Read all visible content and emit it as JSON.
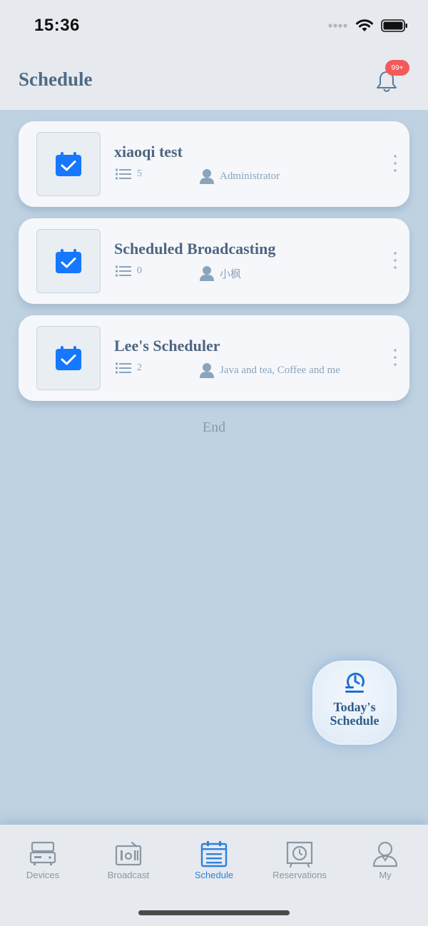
{
  "status_bar": {
    "time": "15:36"
  },
  "header": {
    "title": "Schedule",
    "notification_badge": "99+"
  },
  "schedules": [
    {
      "title": "xiaoqi test",
      "count": "5",
      "owner": "Administrator"
    },
    {
      "title": "Scheduled Broadcasting",
      "count": "0",
      "owner": "小枫"
    },
    {
      "title": "Lee's Scheduler",
      "count": "2",
      "owner": "Java and tea, Coffee and me"
    }
  ],
  "list_end": "End",
  "fab": {
    "label_line1": "Today's",
    "label_line2": "Schedule"
  },
  "tabs": [
    {
      "label": "Devices",
      "icon": "device-icon",
      "active": false
    },
    {
      "label": "Broadcast",
      "icon": "radio-icon",
      "active": false
    },
    {
      "label": "Schedule",
      "icon": "calendar-list-icon",
      "active": true
    },
    {
      "label": "Reservations",
      "icon": "alarm-icon",
      "active": false
    },
    {
      "label": "My",
      "icon": "user-icon",
      "active": false
    }
  ],
  "colors": {
    "accent": "#2e7fe0",
    "page_background": "#bfd2e2",
    "badge": "#f25a5a",
    "calendar_icon": "#1677ff"
  }
}
